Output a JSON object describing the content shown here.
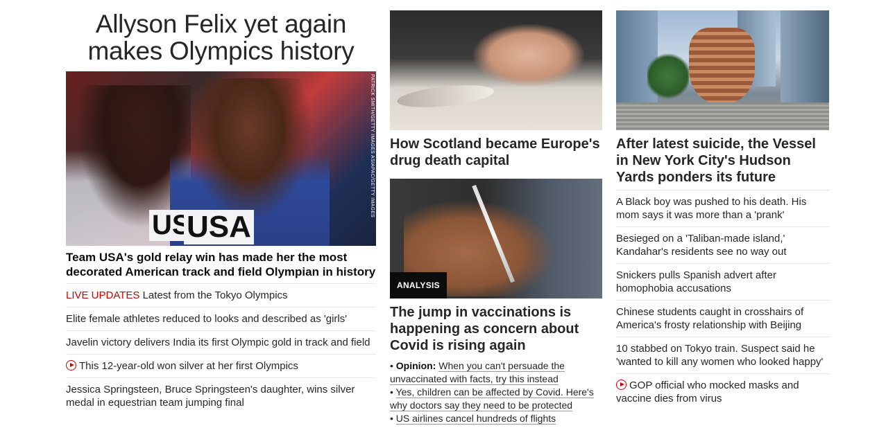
{
  "left": {
    "banner_headline": "Allyson Felix yet again makes Olympics history",
    "photo_credit": "PATRICK SMITH/GETTY IMAGES ASIAPAC/GETTY IMAGES",
    "image_text_1": "US",
    "image_text_2": "USA",
    "lead_headline": "Team USA's gold relay win has made her the most decorated American track and field Olympian in history",
    "links": [
      {
        "prefix": "LIVE UPDATES",
        "text": "Latest from the Tokyo Olympics"
      },
      {
        "text": "Elite female athletes reduced to looks and described as 'girls'"
      },
      {
        "text": "Javelin victory delivers India its first Olympic gold in track and field"
      },
      {
        "video": true,
        "text": "This 12-year-old won silver at her first Olympics"
      },
      {
        "text": "Jessica Springsteen, Bruce Springsteen's daughter, wins silver medal in equestrian team jumping final"
      }
    ]
  },
  "middle": {
    "scotland_headline": "How Scotland became Europe's drug death capital",
    "badge": "ANALYSIS",
    "vax_headline": "The jump in vaccinations is happening as concern about Covid is rising again",
    "sub_links": [
      {
        "bullet": "•",
        "label": "Opinion:",
        "text": "When you can't persuade the unvaccinated with facts, try this instead"
      },
      {
        "bullet": "•",
        "text": "Yes, children can be affected by Covid. Here's why doctors say they need to be protected"
      },
      {
        "bullet": "•",
        "text": "US airlines cancel hundreds of flights"
      }
    ]
  },
  "right": {
    "vessel_headline": "After latest suicide, the Vessel in New York City's Hudson Yards ponders its future",
    "links": [
      {
        "text": "A Black boy was pushed to his death. His mom says it was more than a 'prank'"
      },
      {
        "text": "Besieged on a 'Taliban-made island,' Kandahar's residents see no way out"
      },
      {
        "text": "Snickers pulls Spanish advert after homophobia accusations"
      },
      {
        "text": "Chinese students caught in crosshairs of America's frosty relationship with Beijing"
      },
      {
        "text": "10 stabbed on Tokyo train. Suspect said he 'wanted to kill any women who looked happy'"
      },
      {
        "video": true,
        "text": "GOP official who mocked masks and vaccine dies from virus"
      }
    ]
  },
  "colors": {
    "live": "#cc0000",
    "text": "#262626",
    "badge_bg": "#0c0c0c"
  },
  "icons": {
    "video": "play-circle-icon"
  }
}
